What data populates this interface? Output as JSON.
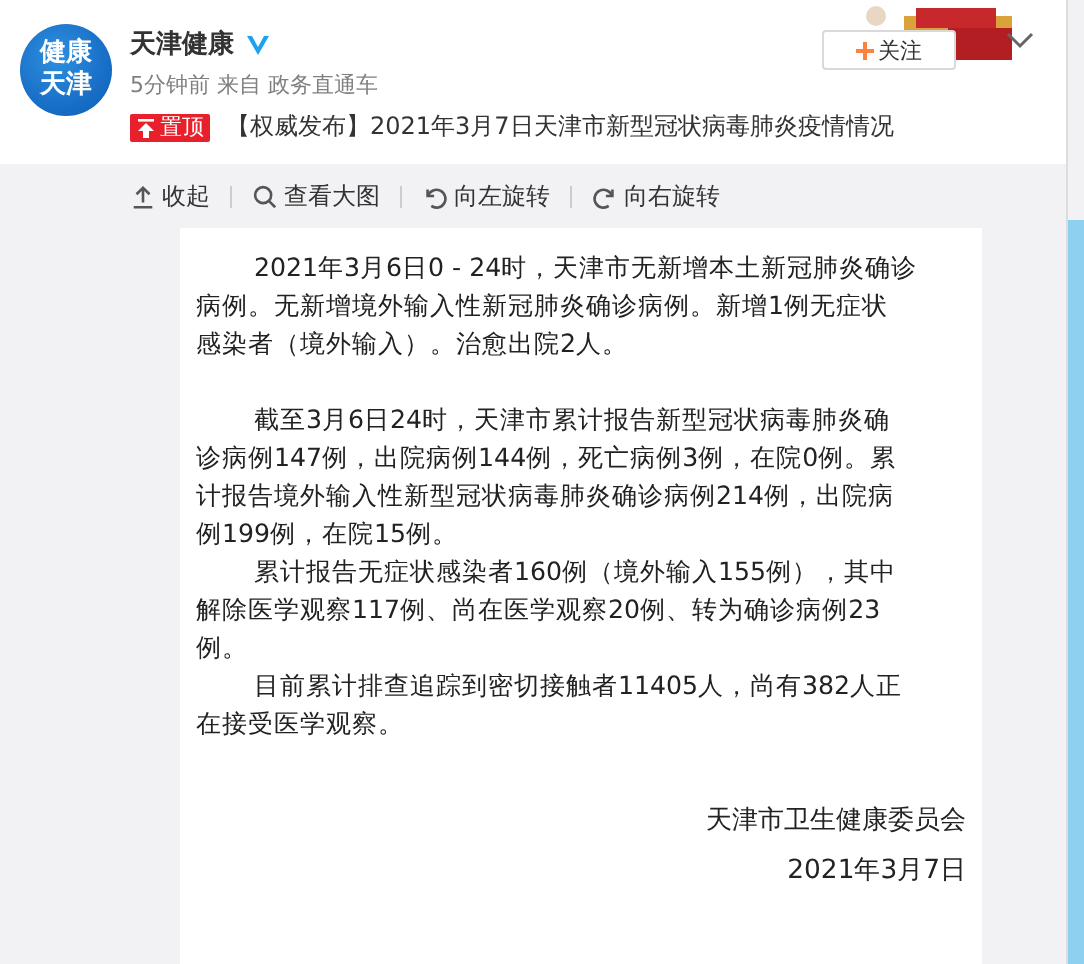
{
  "post": {
    "avatar_text": [
      "健康",
      "天津"
    ],
    "author": "天津健康",
    "verified": true,
    "meta": "5分钟前 来自 政务直通车",
    "follow_button": "关注",
    "pin_badge": "置顶",
    "title": "【权威发布】2021年3月7日天津市新型冠状病毒肺炎疫情情况"
  },
  "image_toolbar": [
    {
      "kind": "collapse",
      "label": "收起"
    },
    {
      "kind": "zoom",
      "label": "查看大图"
    },
    {
      "kind": "rotate_left",
      "label": "向左旋转"
    },
    {
      "kind": "rotate_right",
      "label": "向右旋转"
    }
  ],
  "document": {
    "paragraphs": [
      {
        "lines": [
          "2021年3月6日0 - 24时，天津市无新增本土新冠肺炎确诊",
          "病例。无新增境外输入性新冠肺炎确诊病例。新增1例无症状",
          "感染者（境外输入）。治愈出院2人。"
        ],
        "gap_after": true
      },
      {
        "lines": [
          "截至3月6日24时，天津市累计报告新型冠状病毒肺炎确",
          "诊病例147例，出院病例144例，死亡病例3例，在院0例。累",
          "计报告境外输入性新型冠状病毒肺炎确诊病例214例，出院病",
          "例199例，在院15例。"
        ],
        "gap_after": false
      },
      {
        "lines": [
          "累计报告无症状感染者160例（境外输入155例），其中",
          "解除医学观察117例、尚在医学观察20例、转为确诊病例23",
          "例。"
        ],
        "gap_after": false
      },
      {
        "lines": [
          "目前累计排查追踪到密切接触者11405人，尚有382人正",
          "在接受医学观察。"
        ],
        "gap_after": false
      }
    ],
    "signature": "天津市卫生健康委员会",
    "date": "2021年3月7日"
  }
}
